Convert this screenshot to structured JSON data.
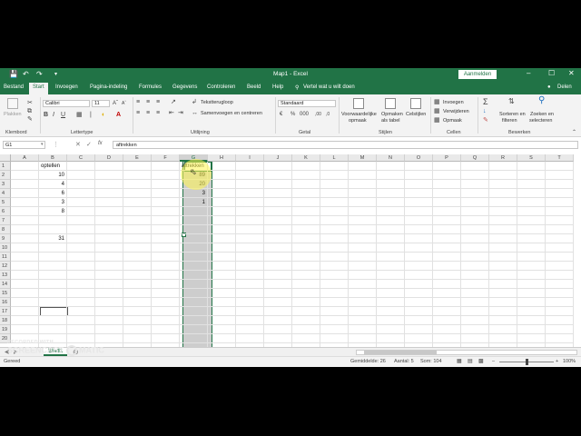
{
  "window": {
    "title": "Map1 - Excel",
    "signin_label": "Aanmelden",
    "share_label": "Delen",
    "accent": "#217346"
  },
  "tabs": [
    "Bestand",
    "Start",
    "Invoegen",
    "Pagina-indeling",
    "Formules",
    "Gegevens",
    "Controleren",
    "Beeld",
    "Help"
  ],
  "active_tab": "Start",
  "tell_me": "Vertel wat u wilt doen",
  "ribbon": {
    "clipboard": {
      "paste": "Plakken",
      "label": "Klembord"
    },
    "font": {
      "name": "Calibri",
      "size": "11",
      "label": "Lettertype"
    },
    "alignment": {
      "wrap": "Tekstterugloop",
      "merge": "Samenvoegen en centreren",
      "label": "Uitlijning"
    },
    "number": {
      "format": "Standaard",
      "label": "Getal"
    },
    "styles": {
      "conditional_1": "Voorwaardelijke",
      "conditional_2": "opmaak",
      "table_1": "Opmaken",
      "table_2": "als tabel",
      "cell_styles": "Celstijlen",
      "label": "Stijlen"
    },
    "cells": {
      "insert": "Invoegen",
      "delete": "Verwijderen",
      "format": "Opmaak",
      "label": "Cellen"
    },
    "editing": {
      "sort_1": "Sorteren en",
      "sort_2": "filteren",
      "find_1": "Zoeken en",
      "find_2": "selecteren",
      "label": "Bewerken"
    }
  },
  "formula_bar": {
    "name_box": "G1",
    "fx": "fx",
    "content": "aftrekken"
  },
  "grid": {
    "columns": [
      "A",
      "B",
      "C",
      "D",
      "E",
      "F",
      "G",
      "H",
      "I",
      "J",
      "K",
      "L",
      "M",
      "N",
      "O",
      "P",
      "Q",
      "R",
      "S",
      "T"
    ],
    "selected_column": "G",
    "rows": [
      "1",
      "2",
      "3",
      "4",
      "5",
      "6",
      "7",
      "8",
      "9",
      "10",
      "11",
      "12",
      "13",
      "14",
      "15",
      "16",
      "17",
      "18",
      "19",
      "20"
    ],
    "cells": {
      "B1": "optellen",
      "B2": "10",
      "B3": "4",
      "B4": "6",
      "B5": "3",
      "B6": "8",
      "B9": "31",
      "G1": "aftrekken",
      "G2": "89",
      "G3": "20",
      "G4": "3",
      "G5": "1"
    }
  },
  "sheets": [
    "Blad1"
  ],
  "status": {
    "ready": "Gereed",
    "average": "Gemiddelde: 26",
    "count": "Aantal: 5",
    "sum": "Som: 104",
    "zoom": "100%"
  },
  "watermark": {
    "line1": "RECORDED WITH",
    "line2": "SCREENCAST",
    "line3": "MATIC"
  }
}
